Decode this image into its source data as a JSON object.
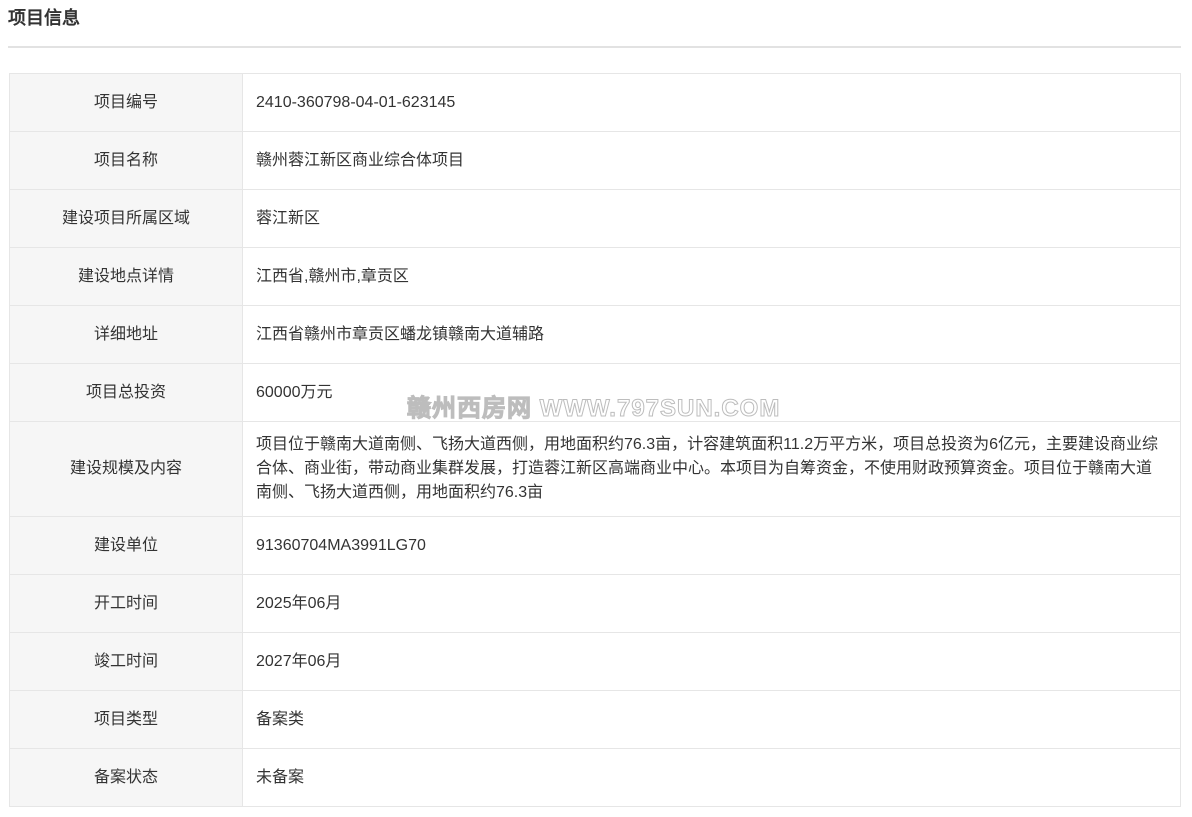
{
  "section": {
    "title": "项目信息"
  },
  "watermark": "赣州西房网 WWW.797SUN.COM",
  "rows": [
    {
      "label": "项目编号",
      "value": "2410-360798-04-01-623145"
    },
    {
      "label": "项目名称",
      "value": "赣州蓉江新区商业综合体项目"
    },
    {
      "label": "建设项目所属区域",
      "value": "蓉江新区"
    },
    {
      "label": "建设地点详情",
      "value": "江西省,赣州市,章贡区"
    },
    {
      "label": "详细地址",
      "value": "江西省赣州市章贡区蟠龙镇赣南大道辅路"
    },
    {
      "label": "项目总投资",
      "value": "60000万元"
    },
    {
      "label": "建设规模及内容",
      "value": "项目位于赣南大道南侧、飞扬大道西侧，用地面积约76.3亩，计容建筑面积11.2万平方米，项目总投资为6亿元，主要建设商业综合体、商业街，带动商业集群发展，打造蓉江新区高端商业中心。本项目为自筹资金，不使用财政预算资金。项目位于赣南大道南侧、飞扬大道西侧，用地面积约76.3亩"
    },
    {
      "label": "建设单位",
      "value": "91360704MA3991LG70"
    },
    {
      "label": "开工时间",
      "value": "2025年06月"
    },
    {
      "label": "竣工时间",
      "value": "2027年06月"
    },
    {
      "label": "项目类型",
      "value": "备案类"
    },
    {
      "label": "备案状态",
      "value": "未备案"
    }
  ]
}
